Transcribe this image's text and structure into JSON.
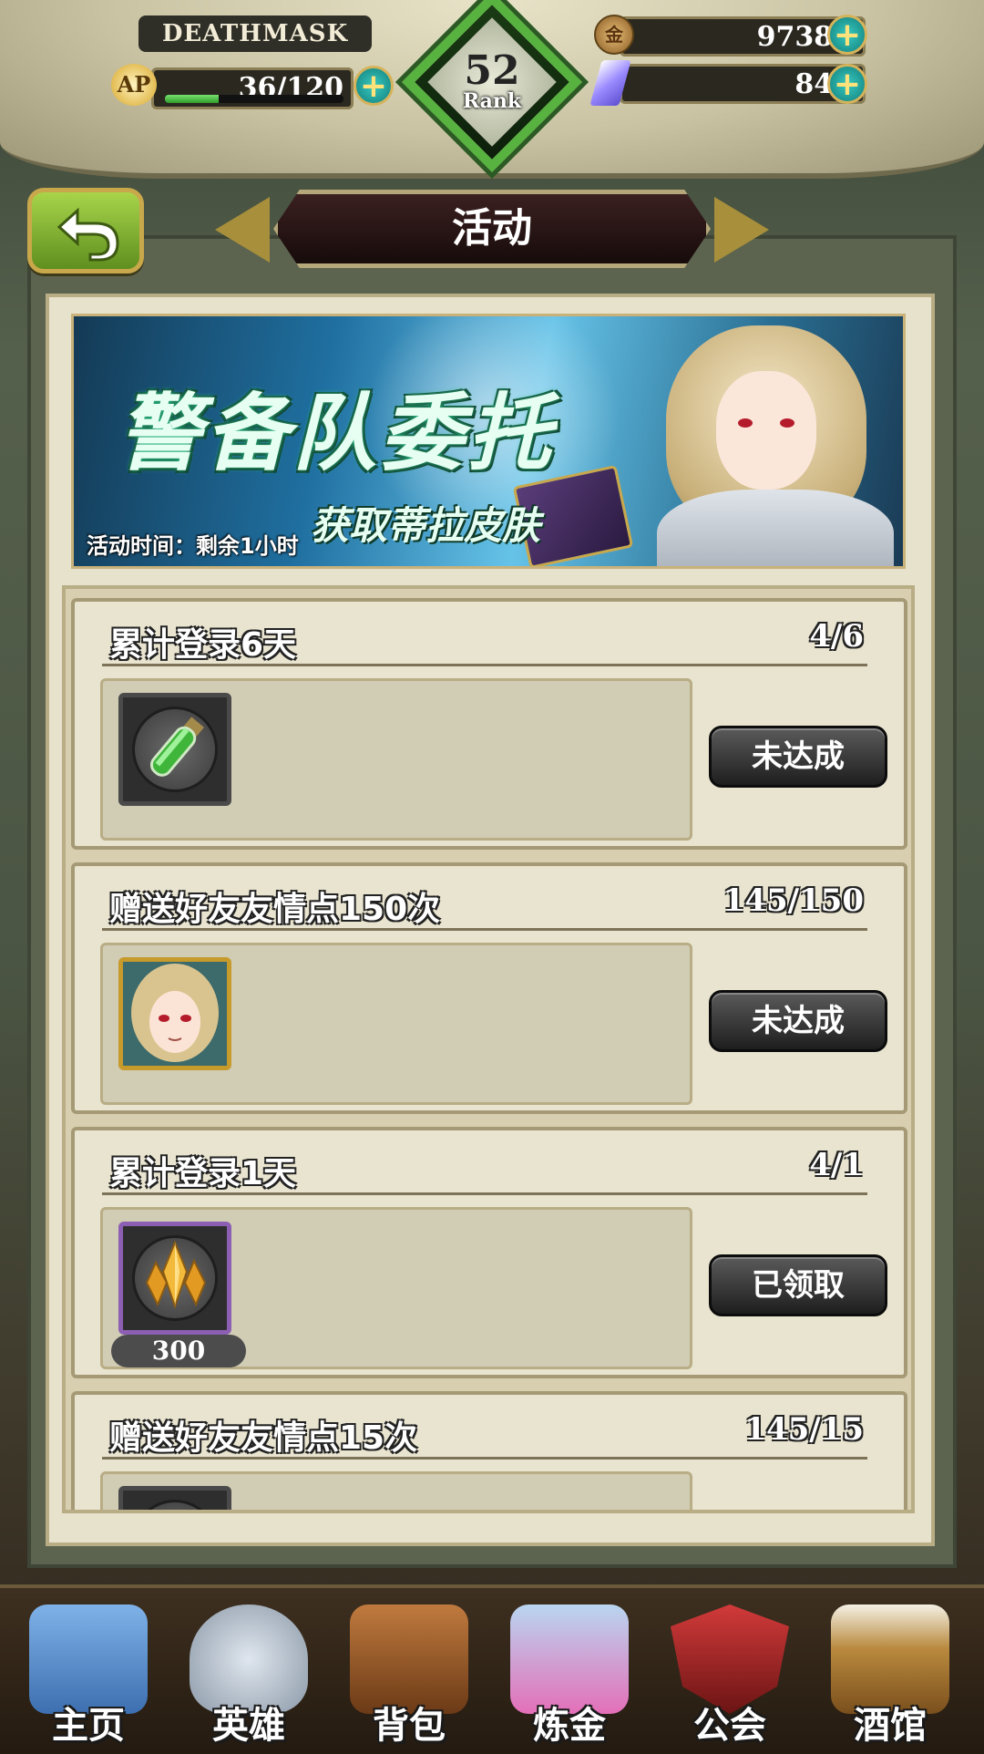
{
  "header": {
    "player_name": "DEATHMASK",
    "ap_label": "AP",
    "ap": "36/120",
    "ap_fraction": 0.3,
    "rank_value": "52",
    "rank_label": "Rank",
    "gold": "97380",
    "gems": "846"
  },
  "title": "活动",
  "banner": {
    "title": "警备队委托",
    "subtitle": "获取蒂拉皮肤",
    "time": "活动时间：剩余1小时"
  },
  "tasks": [
    {
      "title": "累计登录6天",
      "progress": "4/6",
      "reward_icon": "green-potion-icon",
      "reward_count": "",
      "button": "未达成"
    },
    {
      "title": "赠送好友友情点150次",
      "progress": "145/150",
      "reward_icon": "character-portrait-icon",
      "reward_count": "",
      "button": "未达成"
    },
    {
      "title": "累计登录1天",
      "progress": "4/1",
      "reward_icon": "gold-crystal-icon",
      "reward_count": "300",
      "button": "已领取"
    },
    {
      "title": "赠送好友友情点15次",
      "progress": "145/15",
      "reward_icon": "green-potion-icon",
      "reward_count": "",
      "button": ""
    }
  ],
  "nav": [
    {
      "label": "主页",
      "icon": "castle-icon"
    },
    {
      "label": "英雄",
      "icon": "hero-helmet-icon"
    },
    {
      "label": "背包",
      "icon": "backpack-icon"
    },
    {
      "label": "炼金",
      "icon": "alchemy-flask-icon"
    },
    {
      "label": "公会",
      "icon": "guild-shield-icon"
    },
    {
      "label": "酒馆",
      "icon": "tavern-mug-icon"
    }
  ],
  "colors": {
    "accent_green": "#57b23f",
    "plus_teal": "#1ea5a0",
    "panel_bg": "#e7e2cc",
    "button_dark": "#2a2a2a"
  }
}
